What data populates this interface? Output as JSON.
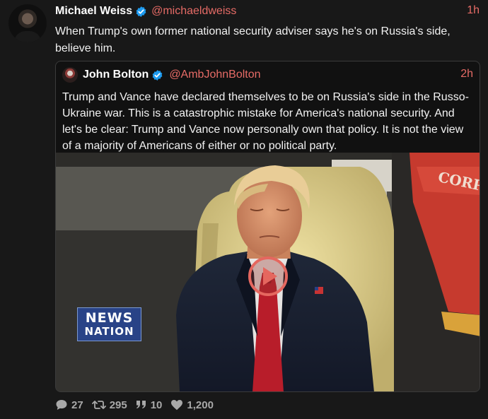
{
  "post": {
    "author_name": "Michael Weiss",
    "author_handle": "@michaeldweiss",
    "time": "1h",
    "text": "When Trump's own former national security adviser says he's on Russia's side, believe him."
  },
  "quoted_post": {
    "author_name": "John Bolton",
    "author_handle": "@AmbJohnBolton",
    "time": "2h",
    "text": "Trump and Vance have declared themselves to be on Russia's side in the Russo-Ukraine war.  This is a catastrophic mistake for America's national security.  And let's be clear:  Trump and Vance now personally own that policy.  It is not the view of a majority of Americans of either or no political party.",
    "video": {
      "logo_line1": "NEWS",
      "logo_line2": "NATION",
      "flag_text": "CORPS"
    }
  },
  "stats": {
    "replies": "27",
    "reposts": "295",
    "quotes": "10",
    "likes": "1,200"
  },
  "colors": {
    "background": "#181818",
    "accent_handle": "#e66b66",
    "verified_blue": "#1d9bf0",
    "play_button": "#e5675f",
    "muted_text": "#a9a9a9"
  },
  "icons": {
    "verified": "verified-badge-icon",
    "play": "play-icon",
    "reply": "speech-bubble-icon",
    "repost": "repost-arrows-icon",
    "quote": "quote-marks-icon",
    "like": "heart-icon"
  }
}
